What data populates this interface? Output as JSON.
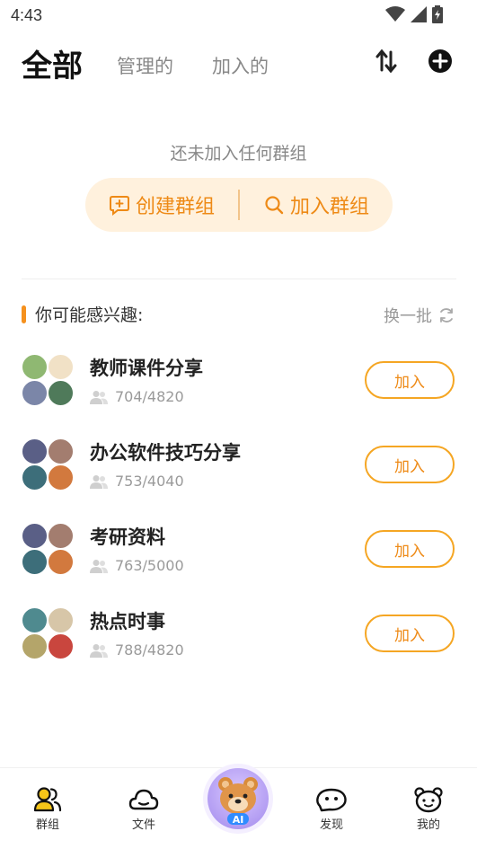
{
  "status": {
    "time": "4:43"
  },
  "header": {
    "tab_all": "全部",
    "tab_managed": "管理的",
    "tab_joined": "加入的"
  },
  "empty": {
    "message": "还未加入任何群组",
    "create_label": "创建群组",
    "join_label": "加入群组"
  },
  "suggest": {
    "title": "你可能感兴趣:",
    "refresh_label": "换一批"
  },
  "groups": [
    {
      "name": "教师课件分享",
      "members": "704/4820",
      "join_label": "加入"
    },
    {
      "name": "办公软件技巧分享",
      "members": "753/4040",
      "join_label": "加入"
    },
    {
      "name": "考研资料",
      "members": "763/5000",
      "join_label": "加入"
    },
    {
      "name": "热点时事",
      "members": "788/4820",
      "join_label": "加入"
    }
  ],
  "tabbar": {
    "groups": "群组",
    "files": "文件",
    "ai": "AI",
    "discover": "发现",
    "mine": "我的"
  },
  "colors": {
    "accent": "#f5911e",
    "accent_light": "#fff1dd",
    "muted": "#999999"
  }
}
